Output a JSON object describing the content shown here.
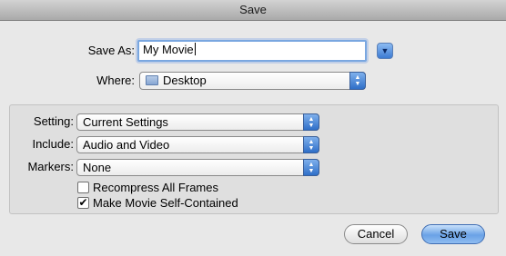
{
  "window": {
    "title": "Save"
  },
  "save_as": {
    "label": "Save As:",
    "value": "My Movie"
  },
  "where": {
    "label": "Where:",
    "value": "Desktop",
    "icon": "folder-icon"
  },
  "options": {
    "setting": {
      "label": "Setting:",
      "value": "Current Settings"
    },
    "include": {
      "label": "Include:",
      "value": "Audio and Video"
    },
    "markers": {
      "label": "Markers:",
      "value": "None"
    },
    "recompress": {
      "label": "Recompress All Frames",
      "checked": false
    },
    "self_contained": {
      "label": "Make Movie Self-Contained",
      "checked": true
    }
  },
  "buttons": {
    "cancel": "Cancel",
    "save": "Save"
  },
  "colors": {
    "accent": "#3c7bd2",
    "window_bg": "#e8e8e8"
  }
}
